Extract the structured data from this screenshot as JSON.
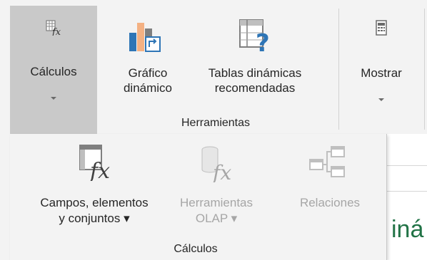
{
  "ribbon": {
    "calculos_button": {
      "label": "Cálculos",
      "icon": "function-box-icon"
    },
    "grafico_button": {
      "label": "Gráfico\ndinámico",
      "icon": "pivot-chart-icon"
    },
    "tablas_button": {
      "label": "Tablas dinámicas\nrecomendadas",
      "icon": "recommended-pivot-icon"
    },
    "herramientas_group_label": "Herramientas",
    "mostrar_button": {
      "label": "Mostrar",
      "icon": "show-list-icon"
    }
  },
  "dropdown": {
    "campos_item": {
      "label": "Campos, elementos\ny conjuntos ▾",
      "icon": "fields-items-sets-icon"
    },
    "herramientas_olap_item": {
      "label": "Herramientas\nOLAP ▾",
      "icon": "olap-tools-icon",
      "disabled": true
    },
    "relaciones_item": {
      "label": "Relaciones",
      "icon": "relationships-icon",
      "disabled": true
    },
    "group_label": "Cálculos"
  },
  "sheet": {
    "partial_title": "iná"
  },
  "colors": {
    "ribbon_bg": "#f3f3f3",
    "selected_bg": "#c9c9c9",
    "accent_green": "#217346",
    "pivot_blue": "#2e75b6",
    "pivot_orange": "#f4b183",
    "help_yellow": "#f2c000",
    "disabled_text": "#a6a6a6"
  }
}
